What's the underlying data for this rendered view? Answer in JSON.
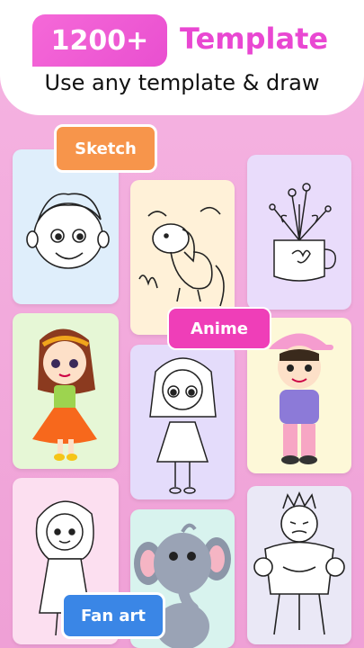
{
  "header": {
    "count": "1200+",
    "title": "Template",
    "subtitle": "Use any template & draw"
  },
  "tags": {
    "sketch": "Sketch",
    "anime": "Anime",
    "fan_art": "Fan art"
  },
  "cards": [
    {
      "name": "boy-face-sketch-card",
      "bg": "#dfeefb"
    },
    {
      "name": "dog-sketch-card",
      "bg": "#fff1d8"
    },
    {
      "name": "flower-mug-sketch-card",
      "bg": "#e9dcfb"
    },
    {
      "name": "girl-doll-color-card",
      "bg": "#e6f7d6"
    },
    {
      "name": "anime-girl-sketch-card",
      "bg": "#e4dcfb"
    },
    {
      "name": "cap-boy-color-card",
      "bg": "#fdf8d8"
    },
    {
      "name": "girl-sketch-card",
      "bg": "#fcdff0"
    },
    {
      "name": "elephant-color-card",
      "bg": "#d8f3ee"
    },
    {
      "name": "hulk-sketch-card",
      "bg": "#eae8f6"
    }
  ]
}
